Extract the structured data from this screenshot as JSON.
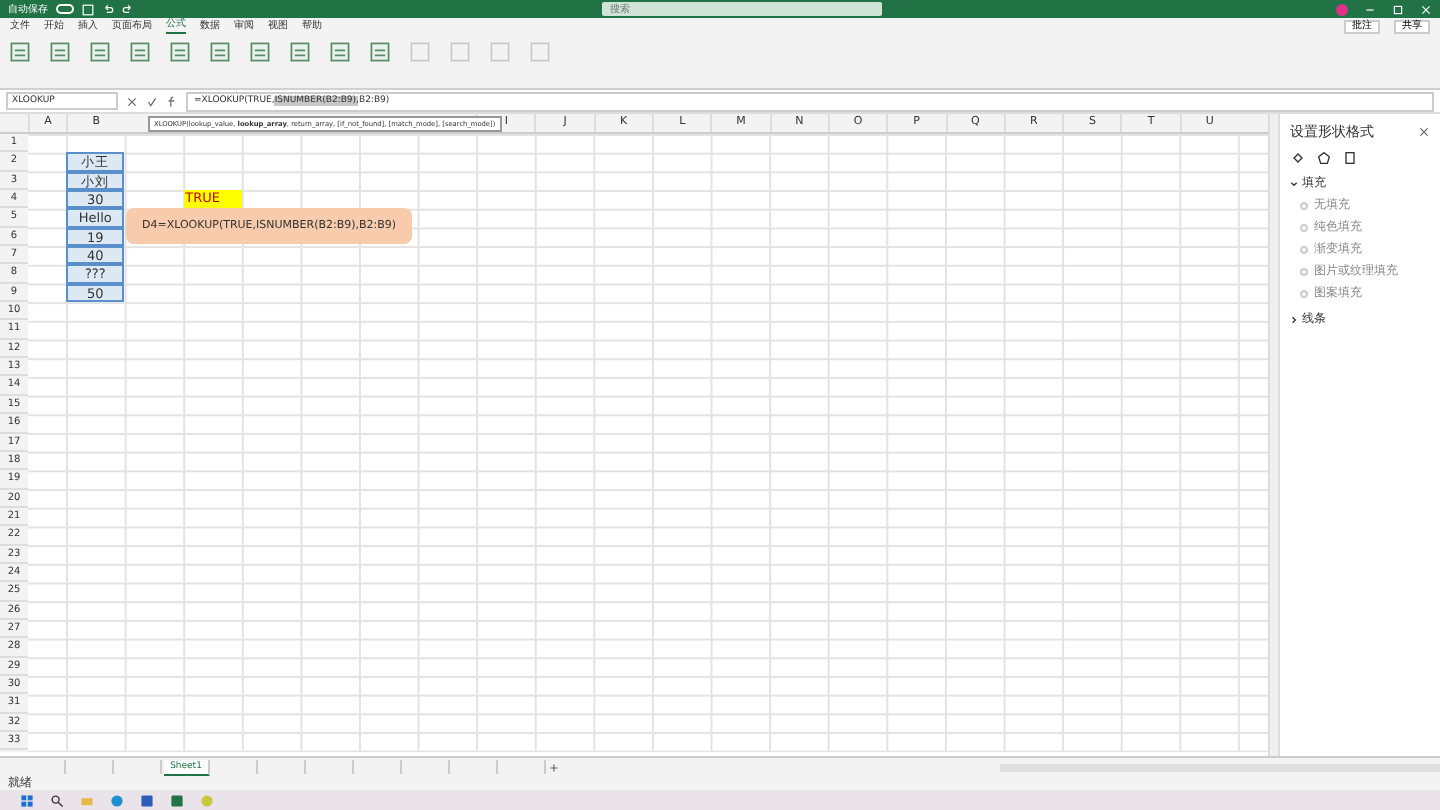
{
  "title_bar": {
    "autosave_label": "自动保存",
    "autosave_on": false,
    "search_placeholder": "搜索"
  },
  "menu_tabs": [
    {
      "label": "文件",
      "selected": false
    },
    {
      "label": "开始",
      "selected": false
    },
    {
      "label": "插入",
      "selected": false
    },
    {
      "label": "页面布局",
      "selected": false
    },
    {
      "label": "公式",
      "selected": true
    },
    {
      "label": "数据",
      "selected": false
    },
    {
      "label": "审阅",
      "selected": false
    },
    {
      "label": "视图",
      "selected": false
    },
    {
      "label": "帮助",
      "selected": false
    }
  ],
  "top_right_buttons": [
    "批注",
    "共享"
  ],
  "formula_bar": {
    "name_box": "XLOOKUP",
    "formula": [
      {
        "text": "=XLOOKUP(TRUE,",
        "selected": false
      },
      {
        "text": "ISNUMBER(B2:B9),",
        "selected": true
      },
      {
        "text": "B2:B9)",
        "selected": false
      }
    ]
  },
  "tooltip": {
    "text": "XLOOKUP(lookup_value, **lookup_array**, return_array, [if_not_found], [match_mode], [search_mode])"
  },
  "sheet": {
    "columns": [
      "A",
      "B",
      "I",
      "J",
      "K",
      "L",
      "M",
      "N",
      "O",
      "P",
      "Q",
      "R",
      "S",
      "T",
      "U"
    ],
    "rows": [
      "1",
      "2",
      "3",
      "4",
      "5",
      "6",
      "7",
      "8",
      "9",
      "10",
      "11",
      "12",
      "13",
      "14",
      "15",
      "16",
      "17",
      "18",
      "19",
      "20",
      "21",
      "22",
      "23",
      "24",
      "25",
      "26",
      "27",
      "28",
      "29",
      "30",
      "31",
      "32",
      "33"
    ],
    "table_values": [
      "小王",
      "小刘",
      "30",
      "Hello",
      "19",
      "40",
      "???",
      "50"
    ],
    "result": {
      "value": "TRUE"
    },
    "note": {
      "text": "D4=XLOOKUP(TRUE,ISNUMBER(B2:B9),B2:B9)"
    }
  },
  "format_pane": {
    "title": "设置形状格式",
    "sections": [
      {
        "label": "填充",
        "expanded": true,
        "options": [
          {
            "label": "无填充",
            "selected": false
          },
          {
            "label": "纯色填充",
            "selected": false
          },
          {
            "label": "渐变填充",
            "selected": false
          },
          {
            "label": "图片或纹理填充",
            "selected": false
          },
          {
            "label": "图案填充",
            "selected": false
          }
        ]
      },
      {
        "label": "线条",
        "expanded": false
      }
    ]
  },
  "sheet_tabs": [
    {
      "selected": false
    },
    {
      "selected": false
    },
    {
      "selected": false
    },
    {
      "label": "Sheet1",
      "selected": true
    },
    {
      "selected": false
    },
    {
      "selected": false
    },
    {
      "selected": false
    },
    {
      "selected": false
    },
    {
      "selected": false
    },
    {
      "selected": false
    },
    {
      "selected": false
    }
  ],
  "status_bar": {
    "text": "就绪"
  }
}
